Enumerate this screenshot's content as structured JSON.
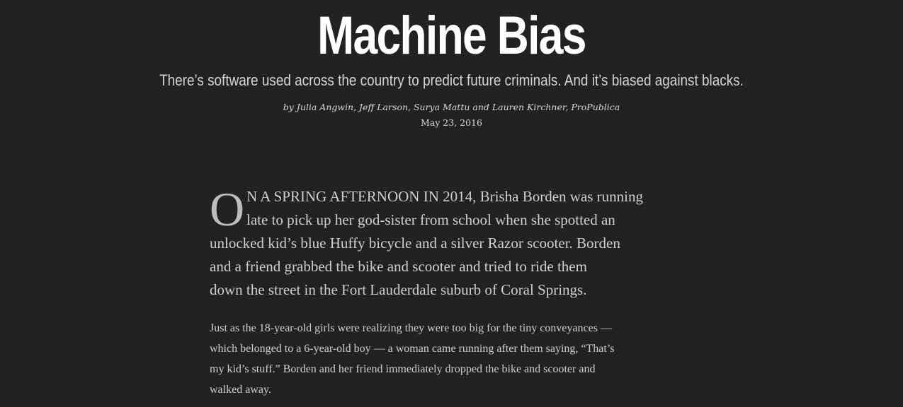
{
  "article": {
    "title": "Machine Bias",
    "dek": "There’s software used across the country to predict future criminals. And it’s biased against blacks.",
    "byline": "by Julia Angwin, Jeff Larson, Surya Mattu and Lauren Kirchner, ProPublica",
    "date": "May 23, 2016",
    "lede": {
      "dropcap": "O",
      "line1_caps": "N A SPRING AFTERNOON IN 2014,",
      "line1_rest": " Brisha Borden was running",
      "line2": "late to pick up her god-sister from school when she spotted an",
      "line3": "unlocked kid’s blue Huffy bicycle and a silver Razor scooter. Borden",
      "line4": "and a friend grabbed the bike and scooter and tried to ride them",
      "line5": "down the street in the Fort Lauderdale suburb of Coral Springs."
    },
    "paragraph2": {
      "line1": "Just as the 18-year-old girls were realizing they were too big for the tiny conveyances —",
      "line2": "which belonged to a 6-year-old boy — a woman came running after them saying, “That’s",
      "line3": "my kid’s stuff.” Borden and her friend immediately dropped the bike and scooter and",
      "line4": "walked away."
    }
  },
  "colors": {
    "background": "#222222",
    "title": "#ffffff",
    "body_text": "#cfcfcf",
    "dropcap": "#bcbcbc"
  }
}
